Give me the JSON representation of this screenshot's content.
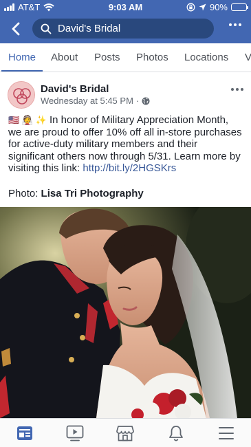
{
  "status_bar": {
    "carrier": "AT&T",
    "time": "9:03 AM",
    "battery": "90%",
    "battery_level": 0.9
  },
  "header": {
    "search_text": "David's Bridal",
    "back_icon": "chevron-left-icon",
    "search_icon": "search-icon",
    "more_icon": "more-horizontal-icon"
  },
  "tabs": [
    {
      "label": "Home",
      "active": true
    },
    {
      "label": "About",
      "active": false
    },
    {
      "label": "Posts",
      "active": false
    },
    {
      "label": "Photos",
      "active": false
    },
    {
      "label": "Locations",
      "active": false
    },
    {
      "label": "V",
      "active": false
    }
  ],
  "post": {
    "author": "David's Bridal",
    "timestamp": "Wednesday at 5:45 PM",
    "separator": "·",
    "privacy_icon": "globe-icon",
    "emojis": "🇺🇸 👰 ✨",
    "text": "In honor of Military Appreciation Month, we are proud to offer 10% off all in-store purchases for active-duty military members and their significant others now through 5/31. Learn more by visiting this link: ",
    "link": "http://bit.ly/2HGSKrs",
    "photo_credit_label": "Photo: ",
    "photo_credit_name": "Lisa Tri Photography",
    "avatar_logo": "DB monogram"
  },
  "bottom_nav": [
    {
      "name": "news-feed-icon",
      "active": true
    },
    {
      "name": "video-icon",
      "active": false
    },
    {
      "name": "marketplace-icon",
      "active": false
    },
    {
      "name": "notifications-icon",
      "active": false
    },
    {
      "name": "menu-icon",
      "active": false
    }
  ],
  "colors": {
    "brand": "#4267b2",
    "search_bg": "#29487d",
    "link": "#385898",
    "text": "#1d2129",
    "muted": "#606770"
  }
}
